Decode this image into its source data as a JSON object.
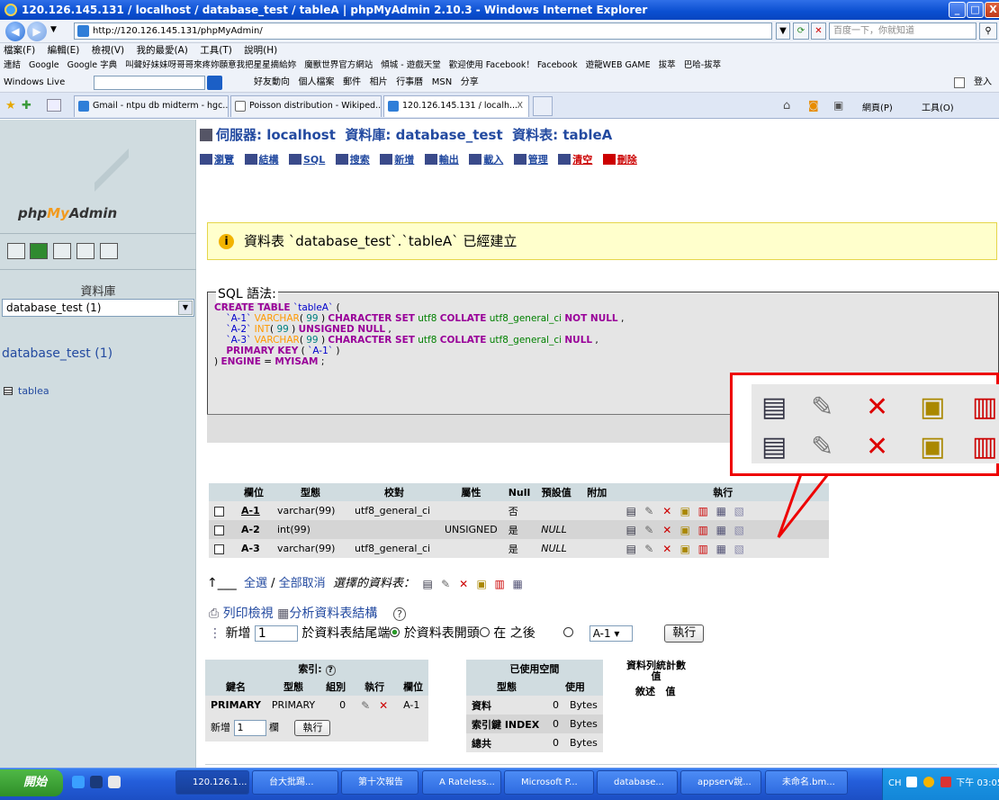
{
  "window": {
    "title": "120.126.145.131 / localhost / database_test / tableA | phpMyAdmin 2.10.3 - Windows Internet Explorer",
    "min": "_",
    "max": "□",
    "close": "X"
  },
  "browser": {
    "address": "http://120.126.145.131/phpMyAdmin/",
    "search_placeholder": "百度一下，你就知道",
    "menu": [
      "檔案(F)",
      "編輯(E)",
      "檢視(V)",
      "我的最愛(A)",
      "工具(T)",
      "說明(H)"
    ],
    "links_label": "連結",
    "links": [
      "Google",
      "Google 字典",
      "叫聲好妹妹呀哥哥來疼妳願意我把星星摘給妳",
      "魔獸世界官方網站",
      "傾城 - 遊戲天堂",
      "歡迎使用 Facebook！ Facebook",
      "遊龍WEB GAME",
      "拔萃",
      "巴哈-拔萃"
    ],
    "wl_label": "Windows Live",
    "wl_links": [
      "好友動向",
      "個人檔案",
      "郵件",
      "相片",
      "行事曆",
      "MSN",
      "分享"
    ],
    "wl_signin": "登入",
    "tabs": [
      "Gmail - ntpu db midterm - hgc...",
      "Poisson distribution - Wikiped...",
      "120.126.145.131 / localh..."
    ],
    "tab_close": "X",
    "cmd": [
      "網頁(P)",
      "工具(O)"
    ]
  },
  "left": {
    "logo_php": "php",
    "logo_my": "My",
    "logo_admin": "Admin",
    "db_label": "資料庫",
    "db_select": "database_test (1)",
    "db_name": "database_test",
    "db_count": "(1)",
    "table": "tablea"
  },
  "main": {
    "crumb_server": "伺服器: localhost",
    "crumb_db": "資料庫: database_test",
    "crumb_table": "資料表: tableA",
    "tabs": [
      "瀏覽",
      "結構",
      "SQL",
      "搜索",
      "新增",
      "輸出",
      "載入",
      "管理",
      "清空",
      "刪除"
    ],
    "notice": "資料表 `database_test`.`tableA` 已經建立",
    "sql_legend": "SQL 語法:",
    "fields_headers": [
      "",
      "欄位",
      "型態",
      "校對",
      "屬性",
      "Null",
      "預設值",
      "附加",
      "執行"
    ],
    "fields": [
      {
        "name": "A-1",
        "type": "varchar(99)",
        "collation": "utf8_general_ci",
        "attr": "",
        "null": "否",
        "default": "",
        "extra": ""
      },
      {
        "name": "A-2",
        "type": "int(99)",
        "collation": "",
        "attr": "UNSIGNED",
        "null": "是",
        "default": "NULL",
        "extra": ""
      },
      {
        "name": "A-3",
        "type": "varchar(99)",
        "collation": "utf8_general_ci",
        "attr": "",
        "null": "是",
        "default": "NULL",
        "extra": ""
      }
    ],
    "select_all": "全選",
    "select_sep": " / ",
    "select_none": "全部取消",
    "selected_label": "選擇的資料表：",
    "print_view": "列印檢視",
    "propose": "分析資料表結構",
    "add_label": "新增",
    "add_count": "1",
    "add_end": "於資料表結尾端",
    "add_start": "於資料表開頭",
    "add_after": "在 之後",
    "add_after_field": "A-1",
    "go": "執行",
    "idx_title": "索引:",
    "idx_headers": [
      "鍵名",
      "型態",
      "組別",
      "執行",
      "欄位"
    ],
    "idx_row": {
      "key": "PRIMARY",
      "type": "PRIMARY",
      "card": "0",
      "field": "A-1"
    },
    "idx_add_label": "新增",
    "idx_add_value": "1",
    "idx_add_suffix": "欄",
    "space_title": "已使用空間",
    "space_headers": [
      "型態",
      "使用"
    ],
    "space_rows": [
      {
        "label": "資料",
        "value": "0",
        "unit": "Bytes"
      },
      {
        "label": "索引鍵 INDEX",
        "value": "0",
        "unit": "Bytes"
      },
      {
        "label": "總共",
        "value": "0",
        "unit": "Bytes"
      }
    ],
    "row_stat_title": "資料列統計數值",
    "row_stat_headers": [
      "敘述",
      "值"
    ]
  },
  "taskbar": {
    "start": "開始",
    "tasks": [
      "120.126.1...",
      "台大批踢...",
      "第十次報告",
      "A Rateless...",
      "Microsoft P...",
      "database...",
      "appserv說...",
      "未命名.bm..."
    ],
    "lang": "CH",
    "clock": "下午 03:05"
  }
}
